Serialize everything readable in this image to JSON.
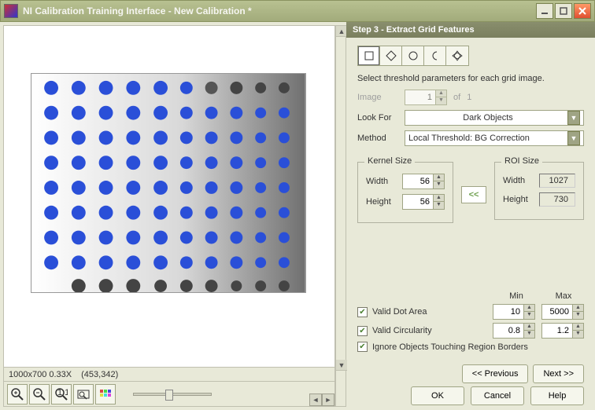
{
  "window": {
    "title": "NI Calibration Training Interface - New Calibration *"
  },
  "status": {
    "dims": "1000x700 0.33X",
    "cursor": "(453,342)"
  },
  "step": {
    "header": "Step 3 - Extract Grid Features",
    "instruction": "Select threshold parameters for each grid image."
  },
  "image": {
    "label": "Image",
    "value": "1",
    "of_label": "of",
    "total": "1"
  },
  "look_for": {
    "label": "Look For",
    "value": "Dark Objects"
  },
  "method": {
    "label": "Method",
    "value": "Local Threshold: BG Correction"
  },
  "kernel": {
    "legend": "Kernel Size",
    "width_label": "Width",
    "width": "56",
    "height_label": "Height",
    "height": "56"
  },
  "roi": {
    "legend": "ROI Size",
    "width_label": "Width",
    "width": "1027",
    "height_label": "Height",
    "height": "730"
  },
  "copy": {
    "label": "<<"
  },
  "valid": {
    "min_label": "Min",
    "max_label": "Max",
    "dot_label": "Valid Dot Area",
    "dot_min": "10",
    "dot_max": "5000",
    "circ_label": "Valid Circularity",
    "circ_min": "0.8",
    "circ_max": "1.2",
    "ignore_label": "Ignore Objects Touching Region Borders"
  },
  "nav": {
    "prev": "<< Previous",
    "next": "Next >>"
  },
  "footer": {
    "ok": "OK",
    "cancel": "Cancel",
    "help": "Help"
  }
}
